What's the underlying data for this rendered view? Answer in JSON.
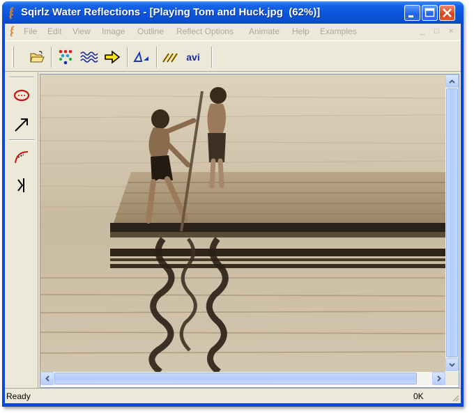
{
  "window": {
    "title": "Sqirlz Water Reflections - [Playing Tom and Huck.jpg  (62%)]",
    "title_color": "#ffffff",
    "titlebar_color": "#0a55dc"
  },
  "title_buttons": {
    "minimize": "minimize-icon",
    "maximize": "maximize-icon",
    "close": "close-icon"
  },
  "menu": {
    "items": [
      "File",
      "Edit",
      "View",
      "Image",
      "Outline",
      "Reflect Options",
      "Animate",
      "Help",
      "Examples"
    ],
    "disabled_color": "#aca899"
  },
  "mdi_controls": {
    "minimize": "_",
    "restore": "□",
    "close": "×"
  },
  "toolbar": {
    "open_icon": "folder-open-icon",
    "ripple_icon": "dots-ripple-icon",
    "wave_icon": "wave-icon",
    "arrow_icon": "yellow-arrow-icon",
    "perspective_icon": "perspective-icon",
    "animate_icon": "animate-lines-icon",
    "avi_label": "avi"
  },
  "left_tools": [
    "ellipse-tool-icon",
    "arrow-tool-icon",
    "curve-tool-icon",
    "split-tool-icon"
  ],
  "status": {
    "left": "Ready",
    "right": "0K"
  },
  "image": {
    "description_name": "photo-canvas"
  }
}
